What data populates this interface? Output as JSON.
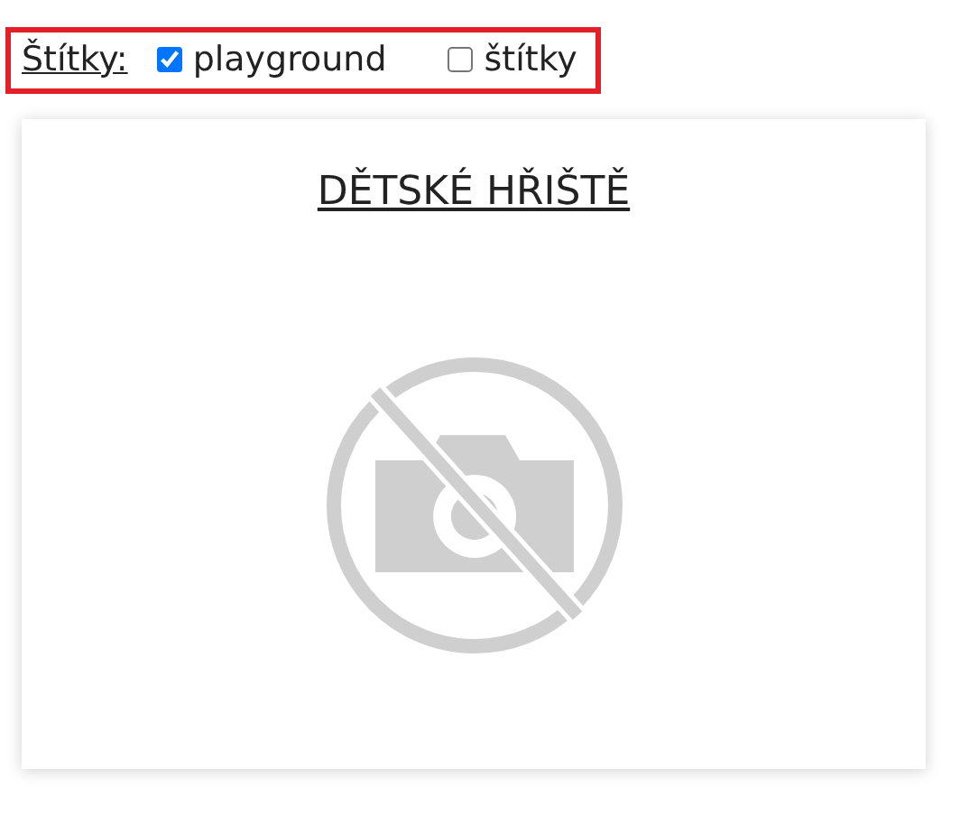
{
  "filter": {
    "label": "Štítky:",
    "options": [
      {
        "label": "playground",
        "checked": true
      },
      {
        "label": "štítky",
        "checked": false
      }
    ]
  },
  "card": {
    "title": "DĚTSKÉ HŘIŠTĚ"
  }
}
